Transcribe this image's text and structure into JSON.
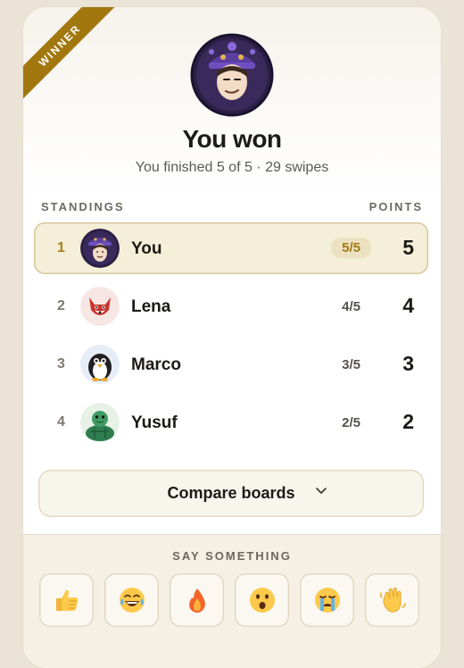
{
  "badge": {
    "label": "WINNER"
  },
  "header": {
    "title": "You won",
    "subtitle": "You finished 5 of 5 · 29 swipes"
  },
  "standings": {
    "heading": "STANDINGS",
    "points_heading": "POINTS",
    "rows": [
      {
        "rank": "1",
        "name": "You",
        "score": "5/5",
        "points": "5",
        "avatar": "wizard-avatar-icon",
        "highlight": true
      },
      {
        "rank": "2",
        "name": "Lena",
        "score": "4/5",
        "points": "4",
        "avatar": "fox-avatar-icon",
        "highlight": false
      },
      {
        "rank": "3",
        "name": "Marco",
        "score": "3/5",
        "points": "3",
        "avatar": "penguin-avatar-icon",
        "highlight": false
      },
      {
        "rank": "4",
        "name": "Yusuf",
        "score": "2/5",
        "points": "2",
        "avatar": "turtle-avatar-icon",
        "highlight": false
      }
    ]
  },
  "compare": {
    "label": "Compare boards"
  },
  "reactions": {
    "heading": "SAY SOMETHING",
    "items": [
      "thumbs-up-icon",
      "laughing-icon",
      "fire-icon",
      "surprised-icon",
      "crying-icon",
      "waving-hand-icon"
    ]
  },
  "colors": {
    "accent_gold": "#a2780e",
    "highlight_bg": "#f5eed8",
    "page_bg": "#ebe4d6"
  }
}
